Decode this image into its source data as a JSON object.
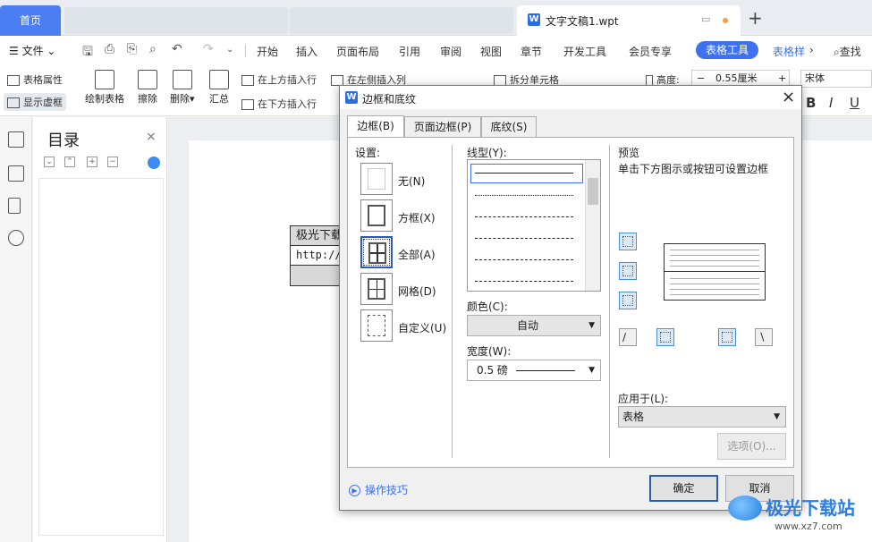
{
  "tabs": {
    "home": "首页",
    "document": "文字文稿1.wpt",
    "new_tab": "+"
  },
  "menu": {
    "file": "文件",
    "items": [
      "开始",
      "插入",
      "页面布局",
      "引用",
      "审阅",
      "视图",
      "章节",
      "开发工具",
      "会员专享"
    ],
    "table_tools": "表格工具",
    "table_style": "表格样",
    "more": "›",
    "search": "查找"
  },
  "ribbon": {
    "table_properties": "表格属性",
    "show_gridlines": "显示虚框",
    "draw_table": "绘制表格",
    "erase": "擦除",
    "delete": "删除",
    "summary": "汇总",
    "insert_above": "在上方插入行",
    "insert_below": "在下方插入行",
    "insert_left": "在左侧插入列",
    "split_cells": "拆分单元格",
    "height_label": "高度:",
    "height_value": "0.55厘米",
    "font_name": "宋体",
    "bold": "B",
    "italic": "I",
    "underline": "U"
  },
  "toc": {
    "title": "目录",
    "close": "×"
  },
  "document": {
    "table_cell_1": "极光下载",
    "table_cell_2": "http://"
  },
  "dialog": {
    "title": "边框和底纹",
    "close": "×",
    "tabs": [
      "边框(B)",
      "页面边框(P)",
      "底纹(S)"
    ],
    "settings_label": "设置:",
    "settings": [
      "无(N)",
      "方框(X)",
      "全部(A)",
      "网格(D)",
      "自定义(U)"
    ],
    "line_style_label": "线型(Y):",
    "color_label": "颜色(C):",
    "color_value": "自动",
    "width_label": "宽度(W):",
    "width_value": "0.5   磅",
    "preview_label": "预览",
    "preview_hint": "单击下方图示或按钮可设置边框",
    "apply_to_label": "应用于(L):",
    "apply_to_value": "表格",
    "options_button": "选项(O)...",
    "tips_link": "操作技巧",
    "ok_button": "确定",
    "cancel_button": "取消"
  },
  "watermark": {
    "text": "极光下载站",
    "url": "www.xz7.com"
  }
}
